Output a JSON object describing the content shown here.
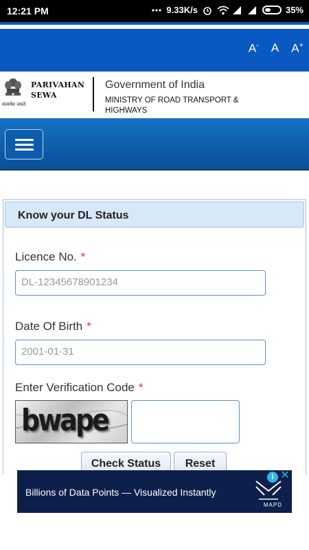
{
  "status_bar": {
    "time": "12:21 PM",
    "network_speed": "9.33K/s",
    "battery": "35%"
  },
  "font_controls": {
    "decrease": "A",
    "decrease_sup": "-",
    "normal": "A",
    "increase": "A",
    "increase_sup": "+"
  },
  "brand": {
    "name_line1": "PARIVAHAN",
    "name_line2": "SEWA",
    "emblem_caption": "सत्यमेव जयते",
    "government": "Government of India",
    "ministry_line1": "MINISTRY OF ROAD TRANSPORT &",
    "ministry_line2": "HIGHWAYS"
  },
  "panel": {
    "title": "Know your DL Status"
  },
  "form": {
    "licence_label": "Licence No.",
    "licence_placeholder": "DL-12345678901234",
    "dob_label": "Date Of Birth",
    "dob_placeholder": "2001-01-31",
    "verification_label": "Enter Verification Code",
    "required_mark": "*",
    "captcha_text": "bwape",
    "check_status_label": "Check Status",
    "reset_label": "Reset"
  },
  "ad": {
    "text": "Billions of Data Points — Visualized Instantly",
    "brand": "MAPD"
  },
  "colors": {
    "header_blue": "#0a58c2",
    "nav_blue": "#1472c5",
    "panel_head": "#d7e8f8",
    "required_red": "#e0302f",
    "ad_bg": "#0d1f4b"
  }
}
